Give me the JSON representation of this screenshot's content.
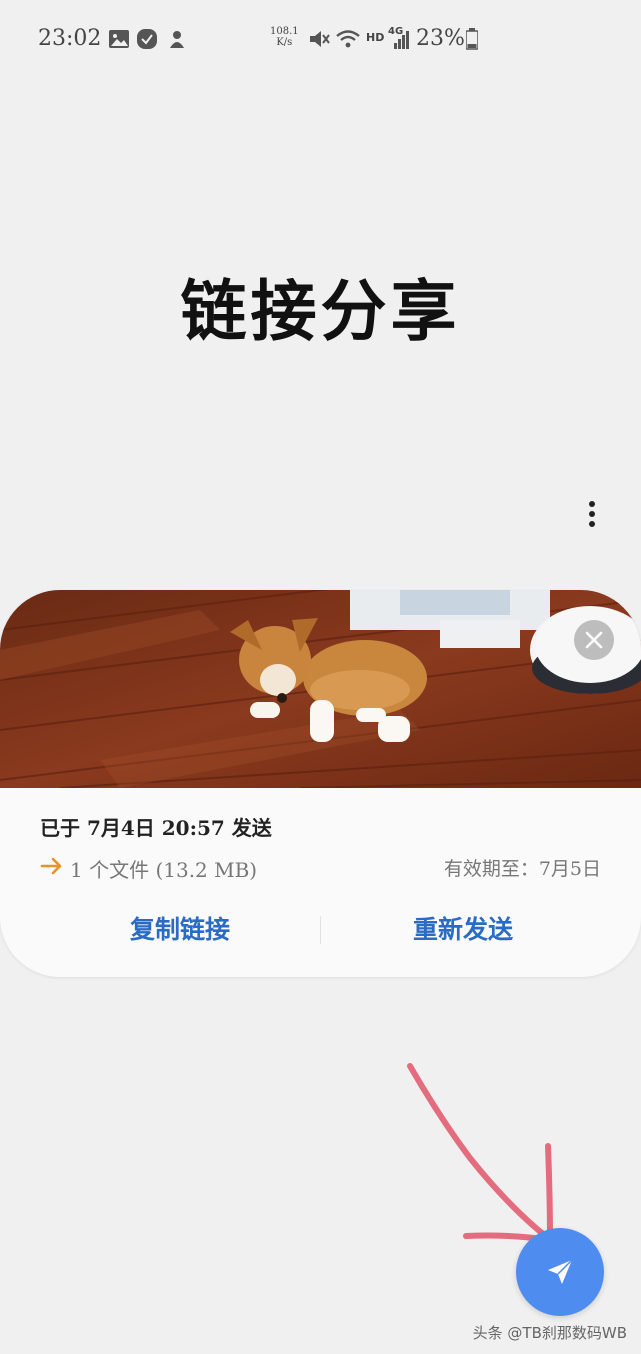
{
  "status_bar": {
    "time": "23:02",
    "net_speed_value": "108.1",
    "net_speed_unit": "K/s",
    "hd_label": "HD",
    "network_label": "4G",
    "battery": "23%",
    "icons": [
      "gallery-icon",
      "check-badge-icon",
      "app-notification-icon",
      "mute-icon",
      "wifi-icon",
      "signal-icon",
      "battery-icon"
    ]
  },
  "header": {
    "title": "链接分享"
  },
  "card": {
    "sent_text": "已于 7月4日 20:57 发送",
    "file_summary": "1 个文件 (13.2 MB)",
    "expiry_text": "有效期至：7月5日",
    "copy_link_label": "复制链接",
    "resend_label": "重新发送"
  },
  "colors": {
    "accent_blue": "#2a6cc4",
    "fab_blue": "#4f8cf0",
    "arrow_orange": "#e8912a",
    "annotation_red": "#e0556a"
  },
  "watermark": "头条 @TB刹那数码WB"
}
